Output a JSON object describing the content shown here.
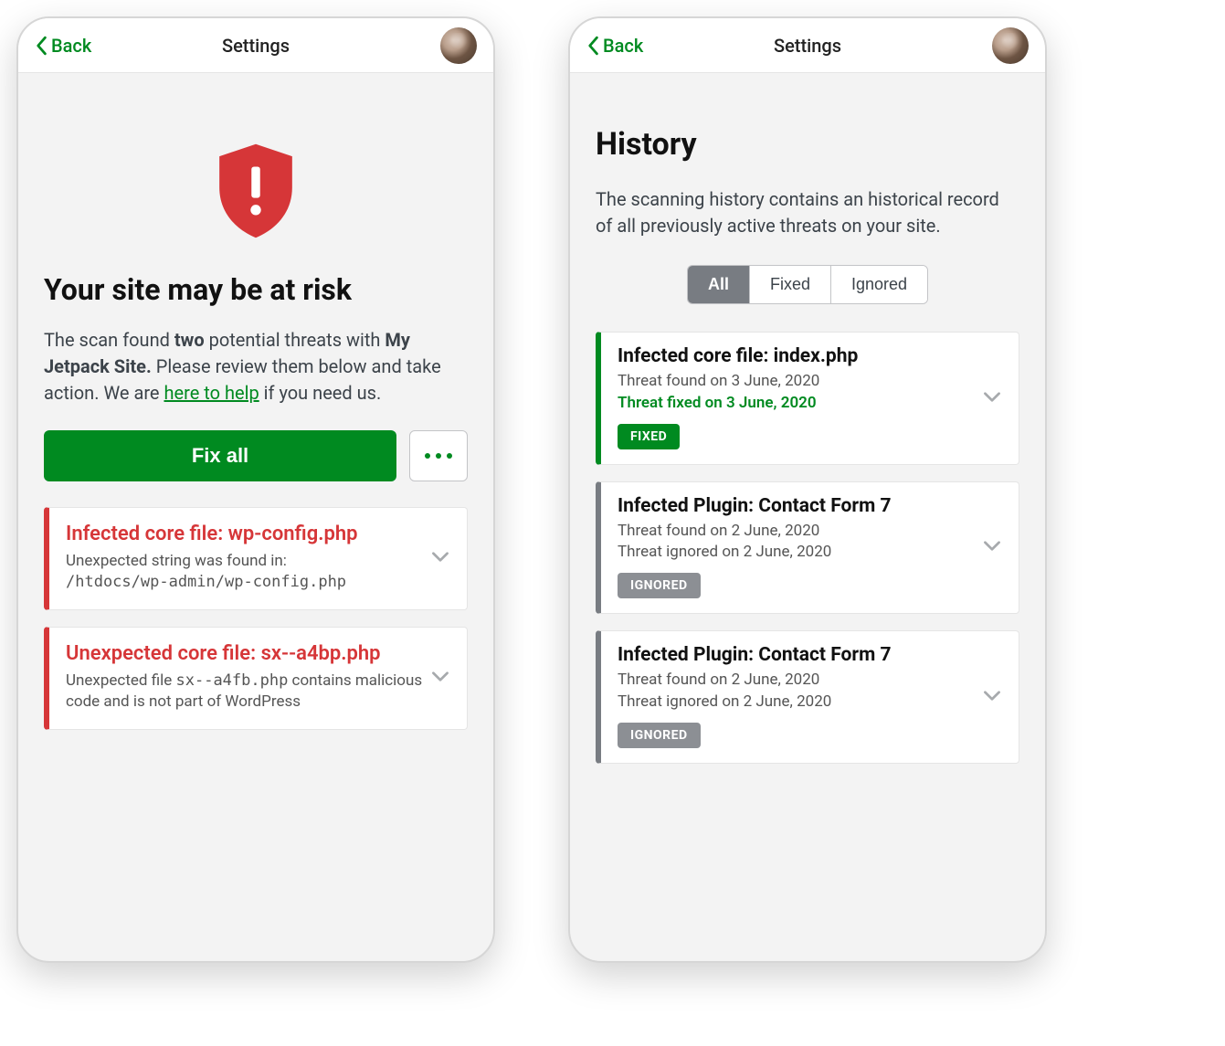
{
  "colors": {
    "accent_green": "#008a20",
    "danger_red": "#d63638",
    "grey": "#787c82"
  },
  "left": {
    "back_label": "Back",
    "title": "Settings",
    "heading": "Your site may be at risk",
    "desc_prefix": "The scan found ",
    "desc_count": "two",
    "desc_mid": " potential threats with ",
    "desc_site": "My Jetpack Site.",
    "desc_suffix1": " Please review them below and take action. We are ",
    "desc_help_link": "here to help",
    "desc_suffix2": " if you need us.",
    "fix_all_label": "Fix all",
    "threats": [
      {
        "title": "Infected core file: wp-config.php",
        "desc_text": "Unexpected string was found in:",
        "desc_mono": "/htdocs/wp-admin/wp-config.php"
      },
      {
        "title": "Unexpected core file: sx--a4bp.php",
        "desc_text_pre": "Unexpected file ",
        "desc_mono": "sx--a4fb.php",
        "desc_text_post": " contains malicious code and is not part of WordPress"
      }
    ]
  },
  "right": {
    "back_label": "Back",
    "title": "Settings",
    "heading": "History",
    "description": "The scanning history contains an historical record of all previously active threats on your site.",
    "filters": {
      "all": "All",
      "fixed": "Fixed",
      "ignored": "Ignored"
    },
    "items": [
      {
        "status": "fixed",
        "title": "Infected core file: index.php",
        "found": "Threat found on 3 June, 2020",
        "resolved": "Threat fixed on 3 June, 2020",
        "badge": "FIXED"
      },
      {
        "status": "ignored",
        "title": "Infected Plugin: Contact Form 7",
        "found": "Threat found on 2 June, 2020",
        "resolved": "Threat ignored on 2 June, 2020",
        "badge": "IGNORED"
      },
      {
        "status": "ignored",
        "title": "Infected Plugin: Contact Form 7",
        "found": "Threat found on 2 June, 2020",
        "resolved": "Threat ignored on 2 June, 2020",
        "badge": "IGNORED"
      }
    ]
  }
}
